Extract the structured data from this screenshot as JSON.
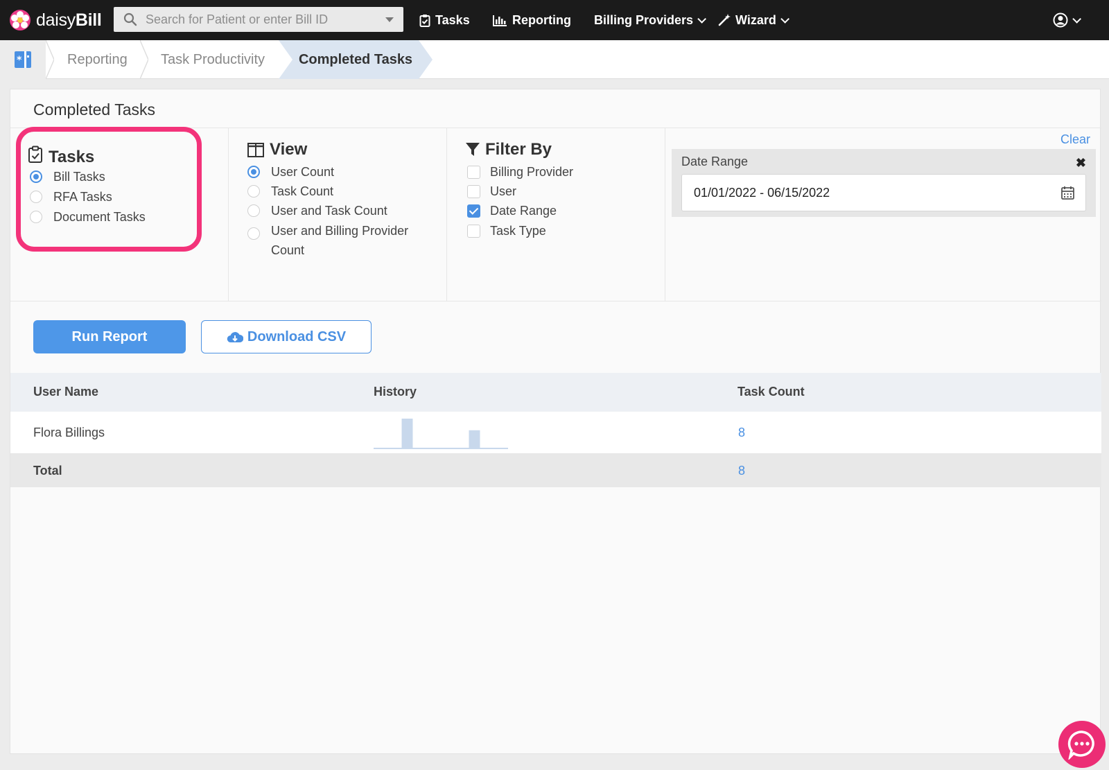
{
  "brand": {
    "name_light": "daisy",
    "name_bold": "Bill"
  },
  "search": {
    "placeholder": "Search for Patient or enter Bill ID"
  },
  "nav": {
    "tasks": "Tasks",
    "reporting": "Reporting",
    "billing_providers": "Billing Providers",
    "wizard": "Wizard"
  },
  "breadcrumb": [
    "Reporting",
    "Task Productivity",
    "Completed Tasks"
  ],
  "panel": {
    "title": "Completed Tasks"
  },
  "tasks_group": {
    "title": "Tasks",
    "options": [
      {
        "label": "Bill Tasks",
        "selected": true
      },
      {
        "label": "RFA Tasks",
        "selected": false
      },
      {
        "label": "Document Tasks",
        "selected": false
      }
    ]
  },
  "view_group": {
    "title": "View",
    "options": [
      {
        "label": "User Count",
        "selected": true
      },
      {
        "label": "Task Count",
        "selected": false
      },
      {
        "label": "User and Task Count",
        "selected": false
      },
      {
        "label": "User and Billing Provider Count",
        "selected": false
      }
    ]
  },
  "filter_group": {
    "title": "Filter By",
    "options": [
      {
        "label": "Billing Provider",
        "checked": false
      },
      {
        "label": "User",
        "checked": false
      },
      {
        "label": "Date Range",
        "checked": true
      },
      {
        "label": "Task Type",
        "checked": false
      }
    ]
  },
  "filters": {
    "clear": "Clear",
    "date_range": {
      "label": "Date Range",
      "value": "01/01/2022 - 06/15/2022"
    }
  },
  "actions": {
    "run": "Run Report",
    "csv": "Download CSV"
  },
  "table": {
    "headers": [
      "User Name",
      "History",
      "Task Count"
    ],
    "rows": [
      {
        "user": "Flora Billings",
        "count": "8",
        "history": [
          0,
          5,
          0,
          0,
          3,
          0
        ]
      }
    ],
    "total": {
      "label": "Total",
      "count": "8"
    }
  },
  "colors": {
    "accent": "#4a90e2",
    "highlight": "#f3337a",
    "brand": "#ec3d8b"
  }
}
